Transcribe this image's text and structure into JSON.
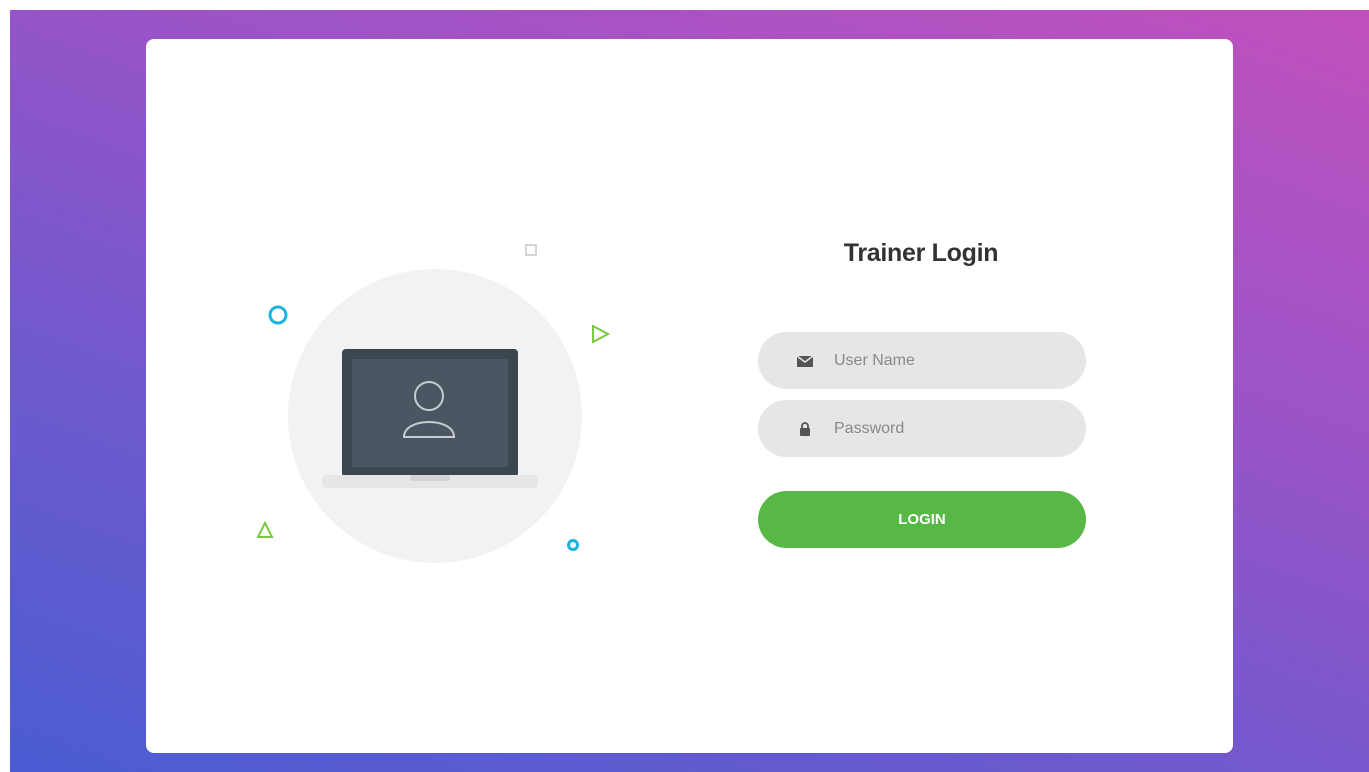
{
  "login": {
    "title": "Trainer Login",
    "username_placeholder": "User Name",
    "password_placeholder": "Password",
    "button_label": "LOGIN"
  },
  "icons": {
    "username": "envelope-icon",
    "password": "lock-icon",
    "illustration": "laptop-user-icon"
  },
  "colors": {
    "background_start": "#4b5cd2",
    "background_end": "#c150bd",
    "button": "#57b846",
    "field": "#e6e6e6",
    "accent_blue": "#1ab3e0",
    "accent_green": "#7ac943"
  }
}
